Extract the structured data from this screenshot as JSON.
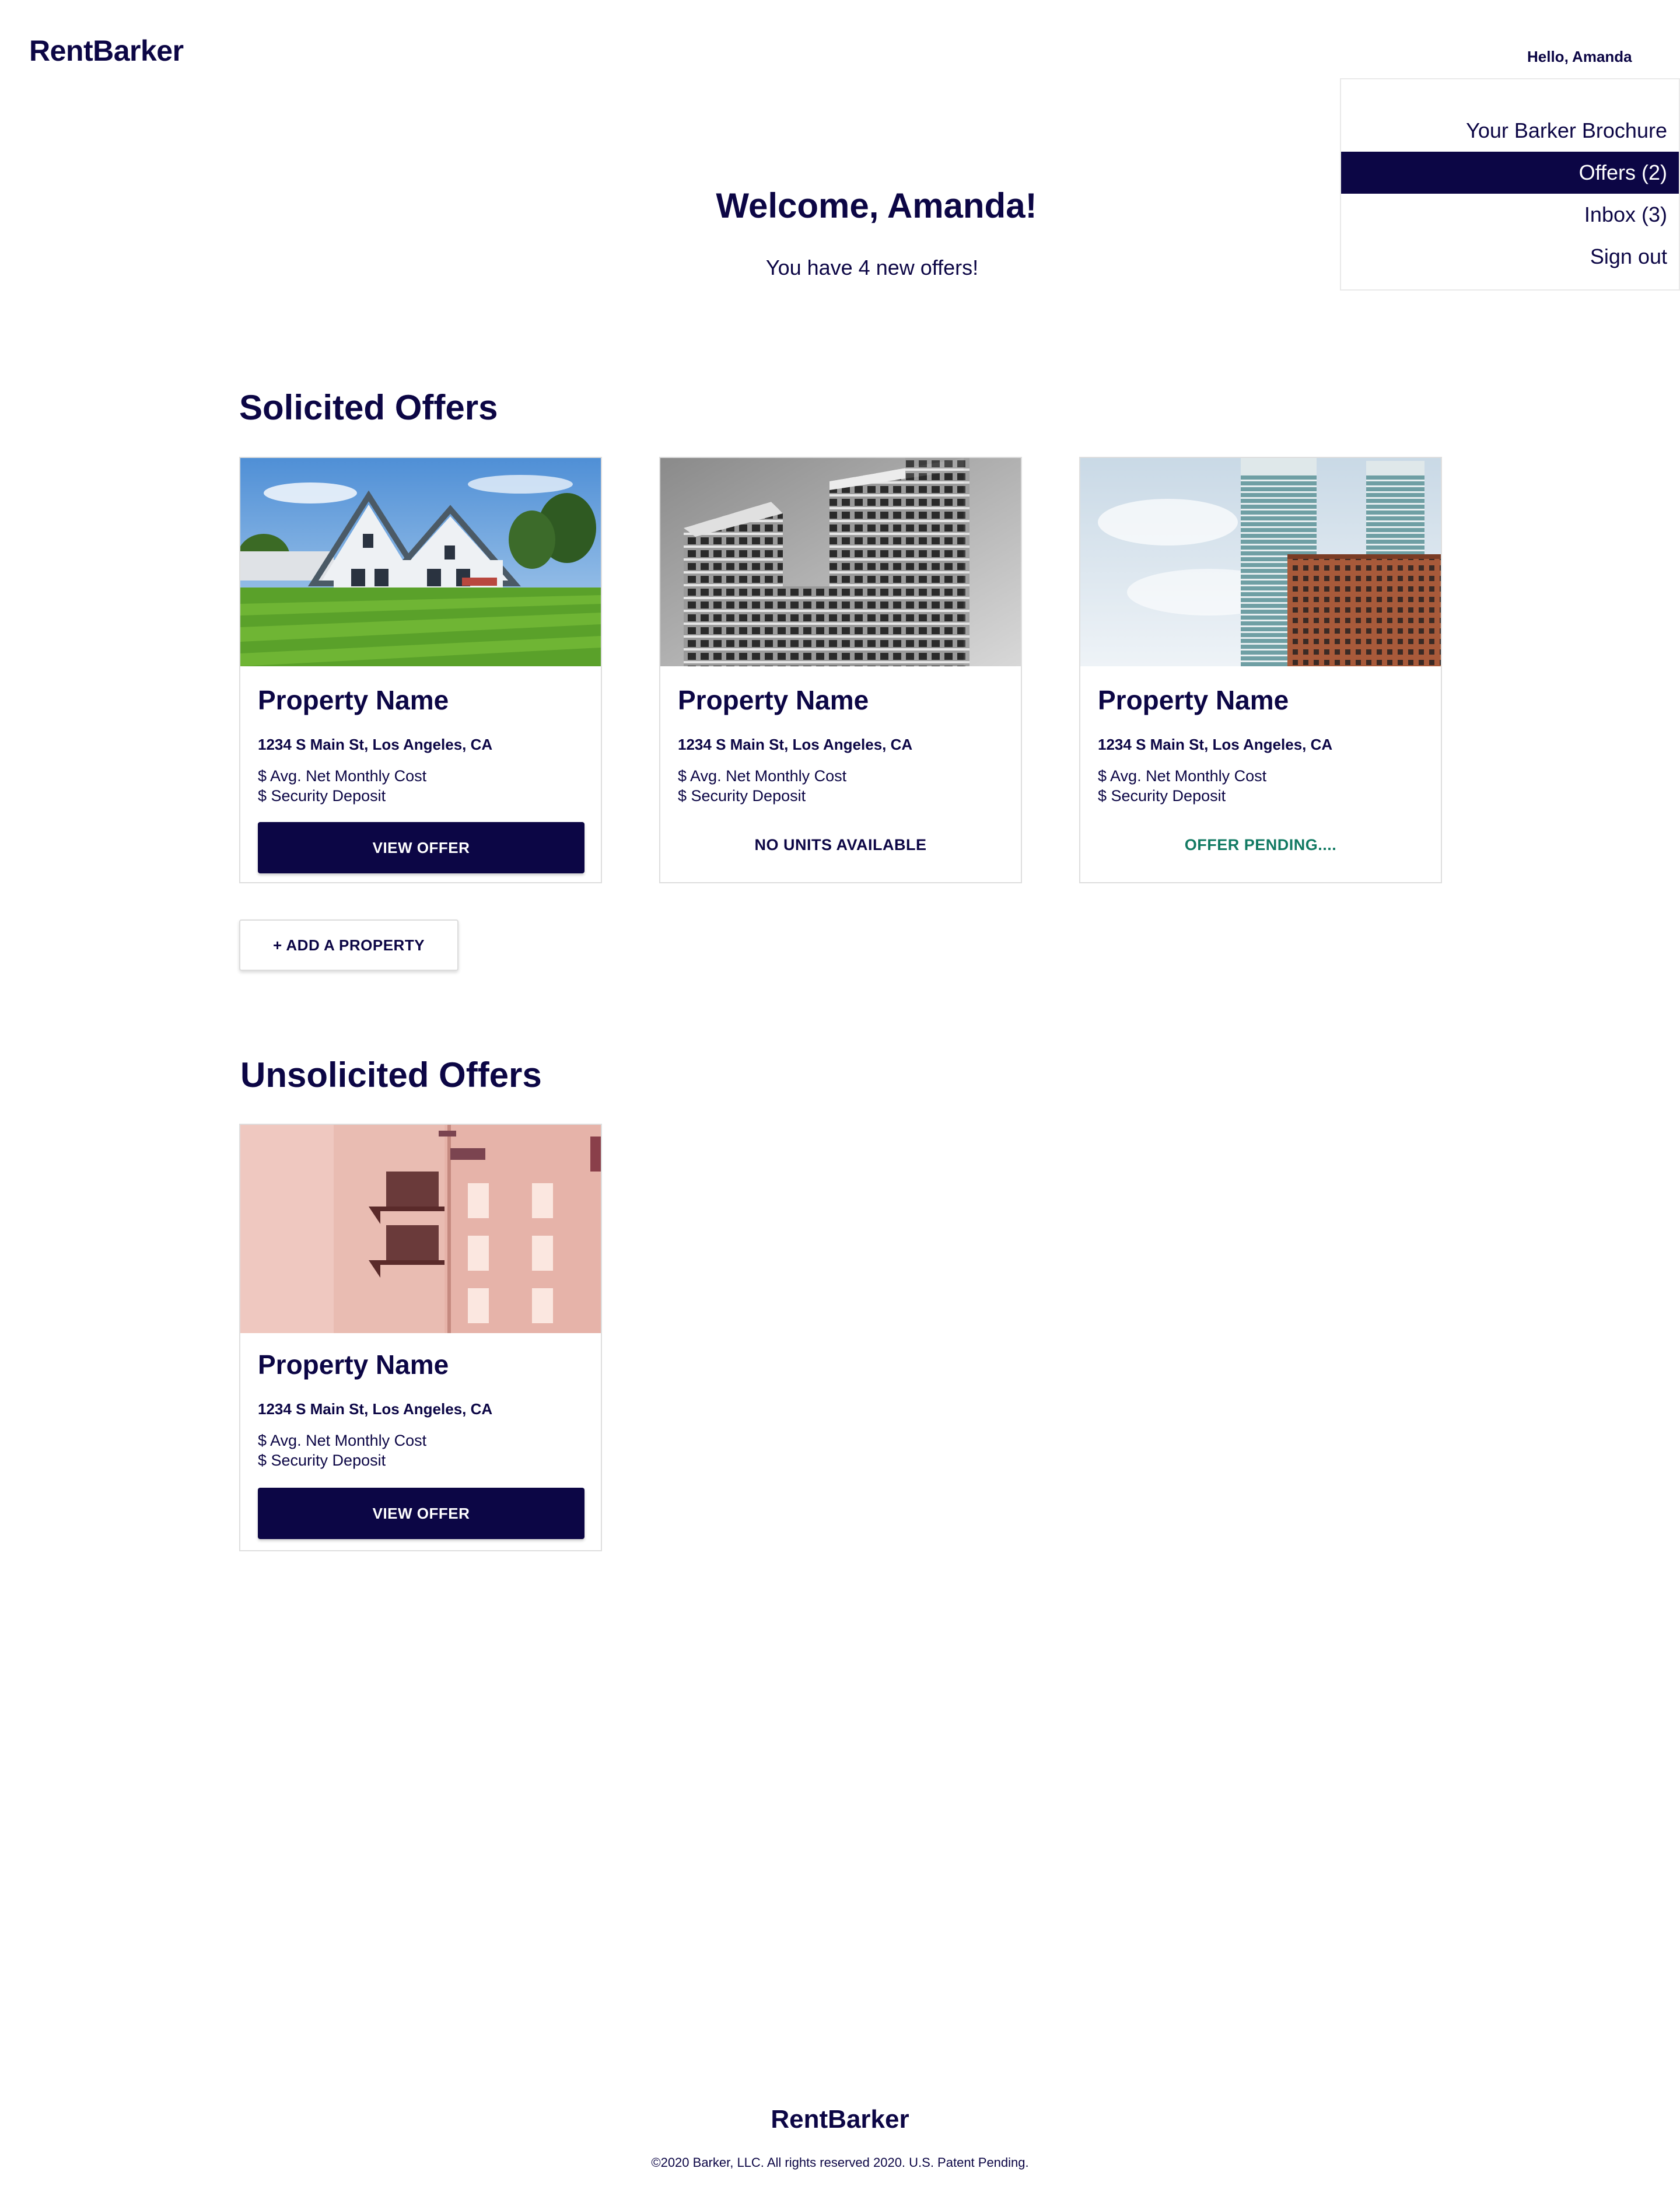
{
  "header": {
    "logo": "RentBarker",
    "greeting": "Hello, Amanda"
  },
  "menu": {
    "items": [
      {
        "label": "Your Barker Brochure",
        "active": false
      },
      {
        "label": "Offers (2)",
        "active": true
      },
      {
        "label": "Inbox (3)",
        "active": false
      },
      {
        "label": "Sign out",
        "active": false
      }
    ]
  },
  "welcome": {
    "title": "Welcome, Amanda!",
    "subtitle": "You have 4 new offers!"
  },
  "solicited": {
    "title": "Solicited Offers",
    "cards": [
      {
        "image": "suburban-house-photo",
        "name": "Property Name",
        "address": "1234 S Main St, Los Angeles, CA",
        "cost": "$ Avg. Net Monthly Cost",
        "deposit": "$ Security Deposit",
        "button": "VIEW OFFER"
      },
      {
        "image": "grayscale-apartment-towers-photo",
        "name": "Property Name",
        "address": "1234 S Main St, Los Angeles, CA",
        "cost": "$ Avg. Net Monthly Cost",
        "deposit": "$ Security Deposit",
        "status": "NO UNITS AVAILABLE",
        "status_color": "#0c0645"
      },
      {
        "image": "glass-high-rise-towers-photo",
        "name": "Property Name",
        "address": "1234 S Main St, Los Angeles, CA",
        "cost": "$ Avg. Net Monthly Cost",
        "deposit": "$ Security Deposit",
        "status": "OFFER PENDING....",
        "status_color": "#127a63"
      }
    ],
    "add_button": "+ ADD A PROPERTY"
  },
  "unsolicited": {
    "title": "Unsolicited Offers",
    "cards": [
      {
        "image": "pink-building-balconies-photo",
        "name": "Property Name",
        "address": "1234 S Main St, Los Angeles, CA",
        "cost": "$ Avg. Net Monthly Cost",
        "deposit": "$ Security Deposit",
        "button": "VIEW OFFER"
      }
    ]
  },
  "footer": {
    "logo": "RentBarker",
    "copyright": "©2020 Barker, LLC. All rights reserved 2020. U.S. Patent Pending."
  },
  "colors": {
    "primary": "#0c0645",
    "pending": "#127a63",
    "border": "#dedede"
  }
}
